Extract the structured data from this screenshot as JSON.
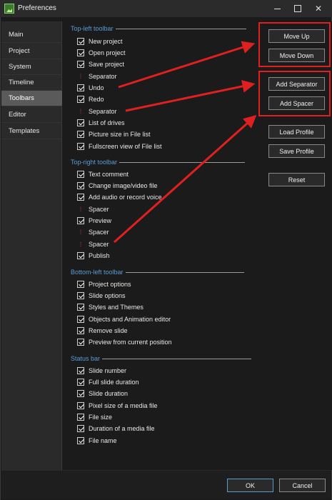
{
  "window": {
    "title": "Preferences",
    "controls": {
      "minimize": "",
      "maximize": "",
      "close": "✕"
    }
  },
  "sidebar": {
    "items": [
      {
        "label": "Main",
        "active": false
      },
      {
        "label": "Project",
        "active": false
      },
      {
        "label": "System",
        "active": false
      },
      {
        "label": "Timeline",
        "active": false
      },
      {
        "label": "Toolbars",
        "active": true
      },
      {
        "label": "Editor",
        "active": false
      },
      {
        "label": "Templates",
        "active": false
      }
    ]
  },
  "sections": {
    "top_left": {
      "title": "Top-left toolbar",
      "items": [
        {
          "label": "New project",
          "kind": "check",
          "checked": true
        },
        {
          "label": "Open project",
          "kind": "check",
          "checked": true
        },
        {
          "label": "Save project",
          "kind": "check",
          "checked": true
        },
        {
          "label": "Separator",
          "kind": "separator",
          "checked": false
        },
        {
          "label": "Undo",
          "kind": "check",
          "checked": true
        },
        {
          "label": "Redo",
          "kind": "check",
          "checked": true
        },
        {
          "label": "Separator",
          "kind": "separator",
          "checked": false
        },
        {
          "label": "List of drives",
          "kind": "check",
          "checked": true
        },
        {
          "label": "Picture size in File list",
          "kind": "check",
          "checked": true
        },
        {
          "label": "Fullscreen view of File list",
          "kind": "check",
          "checked": true
        }
      ]
    },
    "top_right": {
      "title": "Top-right toolbar",
      "items": [
        {
          "label": "Text comment",
          "kind": "check",
          "checked": true
        },
        {
          "label": "Change image/video file",
          "kind": "check",
          "checked": true
        },
        {
          "label": "Add audio or record voice",
          "kind": "check",
          "checked": true
        },
        {
          "label": "Spacer",
          "kind": "separator",
          "checked": false
        },
        {
          "label": "Preview",
          "kind": "check",
          "checked": true
        },
        {
          "label": "Spacer",
          "kind": "separator",
          "checked": false
        },
        {
          "label": "Spacer",
          "kind": "separator",
          "checked": false
        },
        {
          "label": "Publish",
          "kind": "check",
          "checked": true
        }
      ]
    },
    "bottom_left": {
      "title": "Bottom-left toolbar",
      "items": [
        {
          "label": "Project options",
          "kind": "check",
          "checked": true
        },
        {
          "label": "Slide options",
          "kind": "check",
          "checked": true
        },
        {
          "label": "Styles and Themes",
          "kind": "check",
          "checked": true
        },
        {
          "label": "Objects and Animation editor",
          "kind": "check",
          "checked": true
        },
        {
          "label": "Remove slide",
          "kind": "check",
          "checked": true
        },
        {
          "label": "Preview from current position",
          "kind": "check",
          "checked": true
        }
      ]
    },
    "status_bar": {
      "title": "Status bar",
      "items": [
        {
          "label": "Slide number",
          "kind": "check",
          "checked": true
        },
        {
          "label": "Full slide duration",
          "kind": "check",
          "checked": true
        },
        {
          "label": "Slide duration",
          "kind": "check",
          "checked": true
        },
        {
          "label": "Pixel size of a media file",
          "kind": "check",
          "checked": true
        },
        {
          "label": "File size",
          "kind": "check",
          "checked": true
        },
        {
          "label": "Duration of a media file",
          "kind": "check",
          "checked": true
        },
        {
          "label": "File name",
          "kind": "check",
          "checked": true
        }
      ]
    }
  },
  "buttons": {
    "move_up": "Move Up",
    "move_down": "Move Down",
    "add_separator": "Add Separator",
    "add_spacer": "Add Spacer",
    "load_profile": "Load Profile",
    "save_profile": "Save Profile",
    "reset": "Reset",
    "ok": "OK",
    "cancel": "Cancel"
  },
  "separator_glyph": "⁞",
  "colors": {
    "section_title": "#5b9bd5",
    "annotation_red": "#e02020",
    "separator_mark": "#b03a3a",
    "active_nav": "#5a5a5a"
  }
}
